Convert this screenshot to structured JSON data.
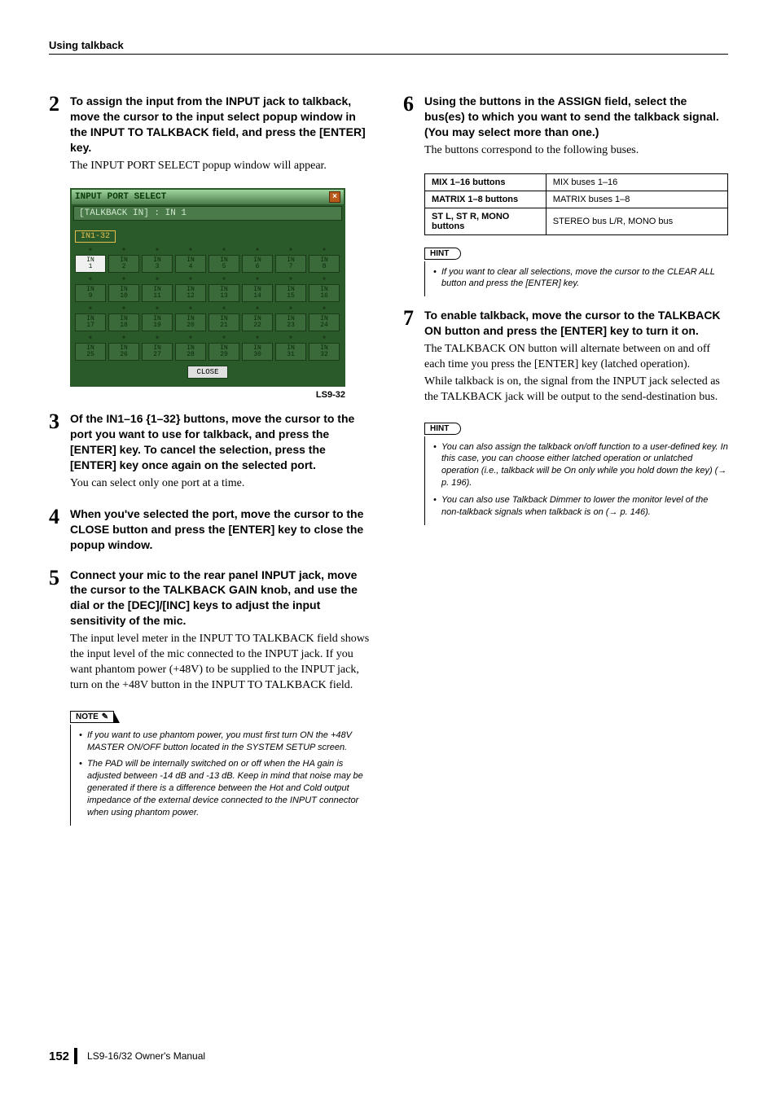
{
  "header": {
    "section": "Using talkback"
  },
  "left": {
    "step2": {
      "num": "2",
      "title": "To assign the input from the INPUT jack to talkback, move the cursor to the input select popup window in the INPUT TO TALKBACK field, and press the [ENTER] key.",
      "body": "The INPUT PORT SELECT popup window will appear."
    },
    "popup": {
      "title": "INPUT PORT SELECT",
      "sub": "[TALKBACK IN] : IN 1",
      "tab": "IN1-32",
      "close": "CLOSE",
      "caption": "LS9-32",
      "grid": [
        [
          "IN\n1",
          "IN\n2",
          "IN\n3",
          "IN\n4",
          "IN\n5",
          "IN\n6",
          "IN\n7",
          "IN\n8"
        ],
        [
          "IN\n9",
          "IN\n10",
          "IN\n11",
          "IN\n12",
          "IN\n13",
          "IN\n14",
          "IN\n15",
          "IN\n16"
        ],
        [
          "IN\n17",
          "IN\n18",
          "IN\n19",
          "IN\n20",
          "IN\n21",
          "IN\n22",
          "IN\n23",
          "IN\n24"
        ],
        [
          "IN\n25",
          "IN\n26",
          "IN\n27",
          "IN\n28",
          "IN\n29",
          "IN\n30",
          "IN\n31",
          "IN\n32"
        ]
      ]
    },
    "step3": {
      "num": "3",
      "title": "Of the IN1–16 {1–32} buttons, move the cursor to the port you want to use for talkback, and press the [ENTER] key. To cancel the selection, press the [ENTER] key once again on the selected port.",
      "body": "You can select only one port at a time."
    },
    "step4": {
      "num": "4",
      "title": "When you've selected the port, move the cursor to the CLOSE button and press the [ENTER] key to close the popup window."
    },
    "step5": {
      "num": "5",
      "title": "Connect your mic to the rear panel INPUT jack, move the cursor to the TALKBACK GAIN knob, and use the dial or the [DEC]/[INC] keys to adjust the input sensitivity of the mic.",
      "body": "The input level meter in the INPUT TO TALKBACK field shows the input level of the mic connected to the INPUT jack. If you want phantom power (+48V) to be supplied to the INPUT jack, turn on the +48V button in the INPUT TO TALKBACK field."
    },
    "note": {
      "tag": "NOTE",
      "b1": "If you want to use phantom power, you must first turn ON the +48V MASTER ON/OFF button located in the SYSTEM SETUP screen.",
      "b2": "The PAD will be internally switched on or off when the HA gain is adjusted between -14 dB and -13 dB. Keep in mind that noise may be generated if there is a difference between the Hot and Cold output impedance of the external device connected to the INPUT connector when using phantom power."
    }
  },
  "right": {
    "step6": {
      "num": "6",
      "title": "Using the buttons in the ASSIGN field, select the bus(es) to which you want to send the talkback signal. (You may select more than one.)",
      "body": "The buttons correspond to the following buses."
    },
    "table": {
      "r1a": "MIX 1–16 buttons",
      "r1b": "MIX buses 1–16",
      "r2a": "MATRIX 1–8 buttons",
      "r2b": "MATRIX buses 1–8",
      "r3a": "ST L, ST R, MONO buttons",
      "r3b": "STEREO bus L/R, MONO bus"
    },
    "hint1": {
      "tag": "HINT",
      "b1": "If you want to clear all selections, move the cursor to the CLEAR ALL button and press the [ENTER] key."
    },
    "step7": {
      "num": "7",
      "title": "To enable talkback, move the cursor to the TALKBACK ON button and press the [ENTER] key to turn it on.",
      "body1": "The TALKBACK ON button will alternate between on and off each time you press the [ENTER] key (latched operation).",
      "body2": "While talkback is on, the signal from the INPUT jack selected as the TALKBACK jack will be output to the send-destination bus."
    },
    "hint2": {
      "tag": "HINT",
      "b1": "You can also assign the talkback on/off function to a user-defined key. In this case, you can choose either latched operation or unlatched operation (i.e., talkback will be On only while you hold down the key) (→ p. 196).",
      "b2": "You can also use Talkback Dimmer to lower the monitor level of the non-talkback signals when talkback is on (→ p. 146)."
    }
  },
  "footer": {
    "pagenum": "152",
    "text": "LS9-16/32  Owner's Manual"
  }
}
